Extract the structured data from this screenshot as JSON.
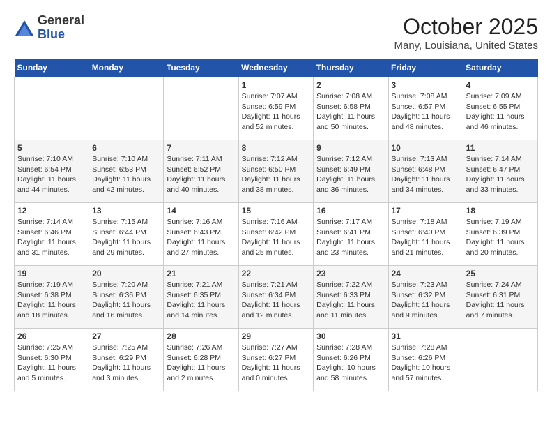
{
  "logo": {
    "general": "General",
    "blue": "Blue"
  },
  "title": "October 2025",
  "location": "Many, Louisiana, United States",
  "days_header": [
    "Sunday",
    "Monday",
    "Tuesday",
    "Wednesday",
    "Thursday",
    "Friday",
    "Saturday"
  ],
  "weeks": [
    [
      {
        "num": "",
        "info": ""
      },
      {
        "num": "",
        "info": ""
      },
      {
        "num": "",
        "info": ""
      },
      {
        "num": "1",
        "info": "Sunrise: 7:07 AM\nSunset: 6:59 PM\nDaylight: 11 hours\nand 52 minutes."
      },
      {
        "num": "2",
        "info": "Sunrise: 7:08 AM\nSunset: 6:58 PM\nDaylight: 11 hours\nand 50 minutes."
      },
      {
        "num": "3",
        "info": "Sunrise: 7:08 AM\nSunset: 6:57 PM\nDaylight: 11 hours\nand 48 minutes."
      },
      {
        "num": "4",
        "info": "Sunrise: 7:09 AM\nSunset: 6:55 PM\nDaylight: 11 hours\nand 46 minutes."
      }
    ],
    [
      {
        "num": "5",
        "info": "Sunrise: 7:10 AM\nSunset: 6:54 PM\nDaylight: 11 hours\nand 44 minutes."
      },
      {
        "num": "6",
        "info": "Sunrise: 7:10 AM\nSunset: 6:53 PM\nDaylight: 11 hours\nand 42 minutes."
      },
      {
        "num": "7",
        "info": "Sunrise: 7:11 AM\nSunset: 6:52 PM\nDaylight: 11 hours\nand 40 minutes."
      },
      {
        "num": "8",
        "info": "Sunrise: 7:12 AM\nSunset: 6:50 PM\nDaylight: 11 hours\nand 38 minutes."
      },
      {
        "num": "9",
        "info": "Sunrise: 7:12 AM\nSunset: 6:49 PM\nDaylight: 11 hours\nand 36 minutes."
      },
      {
        "num": "10",
        "info": "Sunrise: 7:13 AM\nSunset: 6:48 PM\nDaylight: 11 hours\nand 34 minutes."
      },
      {
        "num": "11",
        "info": "Sunrise: 7:14 AM\nSunset: 6:47 PM\nDaylight: 11 hours\nand 33 minutes."
      }
    ],
    [
      {
        "num": "12",
        "info": "Sunrise: 7:14 AM\nSunset: 6:46 PM\nDaylight: 11 hours\nand 31 minutes."
      },
      {
        "num": "13",
        "info": "Sunrise: 7:15 AM\nSunset: 6:44 PM\nDaylight: 11 hours\nand 29 minutes."
      },
      {
        "num": "14",
        "info": "Sunrise: 7:16 AM\nSunset: 6:43 PM\nDaylight: 11 hours\nand 27 minutes."
      },
      {
        "num": "15",
        "info": "Sunrise: 7:16 AM\nSunset: 6:42 PM\nDaylight: 11 hours\nand 25 minutes."
      },
      {
        "num": "16",
        "info": "Sunrise: 7:17 AM\nSunset: 6:41 PM\nDaylight: 11 hours\nand 23 minutes."
      },
      {
        "num": "17",
        "info": "Sunrise: 7:18 AM\nSunset: 6:40 PM\nDaylight: 11 hours\nand 21 minutes."
      },
      {
        "num": "18",
        "info": "Sunrise: 7:19 AM\nSunset: 6:39 PM\nDaylight: 11 hours\nand 20 minutes."
      }
    ],
    [
      {
        "num": "19",
        "info": "Sunrise: 7:19 AM\nSunset: 6:38 PM\nDaylight: 11 hours\nand 18 minutes."
      },
      {
        "num": "20",
        "info": "Sunrise: 7:20 AM\nSunset: 6:36 PM\nDaylight: 11 hours\nand 16 minutes."
      },
      {
        "num": "21",
        "info": "Sunrise: 7:21 AM\nSunset: 6:35 PM\nDaylight: 11 hours\nand 14 minutes."
      },
      {
        "num": "22",
        "info": "Sunrise: 7:21 AM\nSunset: 6:34 PM\nDaylight: 11 hours\nand 12 minutes."
      },
      {
        "num": "23",
        "info": "Sunrise: 7:22 AM\nSunset: 6:33 PM\nDaylight: 11 hours\nand 11 minutes."
      },
      {
        "num": "24",
        "info": "Sunrise: 7:23 AM\nSunset: 6:32 PM\nDaylight: 11 hours\nand 9 minutes."
      },
      {
        "num": "25",
        "info": "Sunrise: 7:24 AM\nSunset: 6:31 PM\nDaylight: 11 hours\nand 7 minutes."
      }
    ],
    [
      {
        "num": "26",
        "info": "Sunrise: 7:25 AM\nSunset: 6:30 PM\nDaylight: 11 hours\nand 5 minutes."
      },
      {
        "num": "27",
        "info": "Sunrise: 7:25 AM\nSunset: 6:29 PM\nDaylight: 11 hours\nand 3 minutes."
      },
      {
        "num": "28",
        "info": "Sunrise: 7:26 AM\nSunset: 6:28 PM\nDaylight: 11 hours\nand 2 minutes."
      },
      {
        "num": "29",
        "info": "Sunrise: 7:27 AM\nSunset: 6:27 PM\nDaylight: 11 hours\nand 0 minutes."
      },
      {
        "num": "30",
        "info": "Sunrise: 7:28 AM\nSunset: 6:26 PM\nDaylight: 10 hours\nand 58 minutes."
      },
      {
        "num": "31",
        "info": "Sunrise: 7:28 AM\nSunset: 6:26 PM\nDaylight: 10 hours\nand 57 minutes."
      },
      {
        "num": "",
        "info": ""
      }
    ]
  ]
}
